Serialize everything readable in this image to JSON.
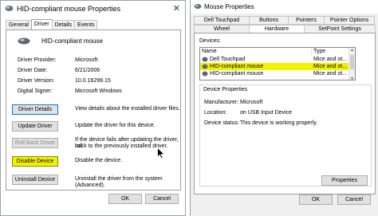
{
  "left_window": {
    "title": "HID-compliant mouse Properties",
    "close_glyph": "✕",
    "tabs": [
      "General",
      "Driver",
      "Details",
      "Events"
    ],
    "active_tab": "Driver",
    "device_name": "HID-compliant mouse",
    "properties": [
      {
        "label": "Driver Provider:",
        "value": "Microsoft"
      },
      {
        "label": "Driver Date:",
        "value": "6/21/2006"
      },
      {
        "label": "Driver Version:",
        "value": "10.0.16299.15"
      },
      {
        "label": "Digital Signer:",
        "value": "Microsoft Windows"
      }
    ],
    "actions": [
      {
        "button": "Driver Details",
        "desc1": "View details about the installed driver files.",
        "desc2": ""
      },
      {
        "button": "Update Driver",
        "desc1": "Update the driver for this device.",
        "desc2": ""
      },
      {
        "button": "Roll Back Driver",
        "desc1": "If the device fails after updating the driver, roll",
        "desc2": "back to the previously installed driver."
      },
      {
        "button": "Disable Device",
        "desc1": "Disable the device.",
        "desc2": ""
      },
      {
        "button": "Uninstall Device",
        "desc1": "Uninstall the driver from the system (Advanced).",
        "desc2": ""
      }
    ],
    "ok": "OK",
    "cancel": "Cancel"
  },
  "right_window": {
    "title": "Mouse Properties",
    "tabs_row1": [
      "Dell Touchpad",
      "Buttons",
      "Pointers",
      "Pointer Options"
    ],
    "tabs_row2": [
      "Wheel",
      "Hardware",
      "SetPoint Settings"
    ],
    "active_tab": "Hardware",
    "devices_label": "Devices:",
    "columns": [
      "Name",
      "Type"
    ],
    "devices": [
      {
        "name": "Dell Touchpad",
        "type": "Mice and ot..."
      },
      {
        "name": "HID-compliant mouse",
        "type": "Mice and ot..."
      },
      {
        "name": "HID-compliant mouse",
        "type": "Mice and ot..."
      }
    ],
    "selected_row": 1,
    "group_title": "Device Properties",
    "details": [
      {
        "label": "Manufacturer:",
        "value": "Microsoft"
      },
      {
        "label": "Location:",
        "value": "on USB Input Device"
      },
      {
        "label": "Device status:",
        "value": "This device is working properly."
      }
    ],
    "properties_button": "Properties",
    "ok": "OK",
    "cancel": "Cancel"
  },
  "colors": {
    "highlight": "#f2f200",
    "focus_border": "#0078d7"
  }
}
